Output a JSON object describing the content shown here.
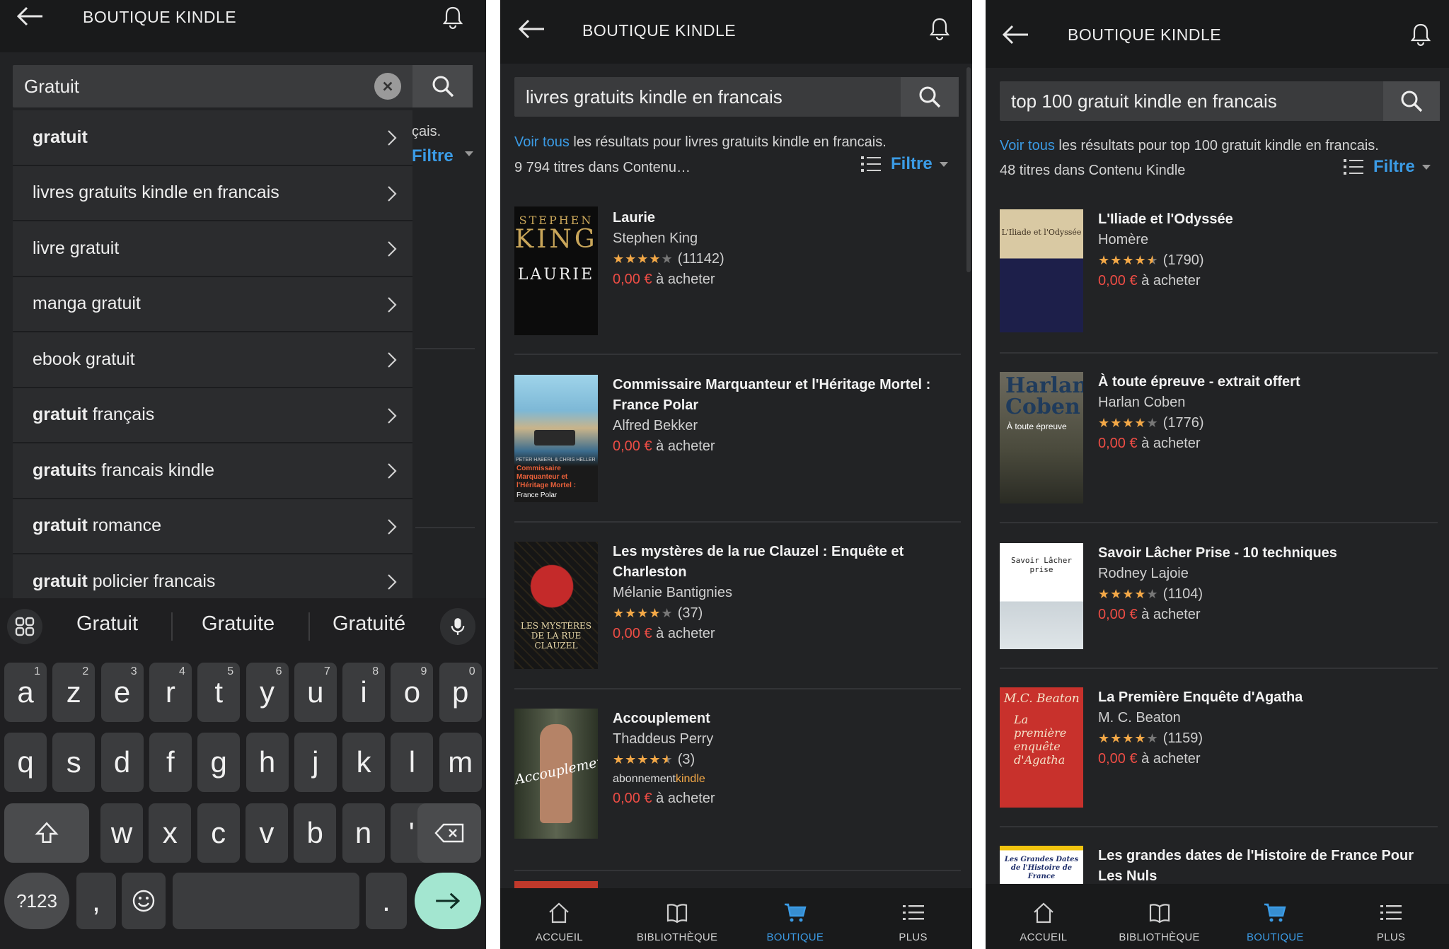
{
  "panel1": {
    "title": "BOUTIQUE KINDLE",
    "search_value": "Gratuit",
    "behind_text_1": "çais.",
    "behind_text_2": "Filtre",
    "suggestions": [
      {
        "bold": "gratuit",
        "rest": ""
      },
      {
        "bold": "",
        "rest": "livres gratuits kindle en francais"
      },
      {
        "bold": "",
        "rest": "livre gratuit"
      },
      {
        "bold": "",
        "rest": "manga gratuit"
      },
      {
        "bold": "",
        "rest": "ebook gratuit"
      },
      {
        "bold": "gratuit",
        "rest": " français"
      },
      {
        "bold": "gratuit",
        "rest": "s francais kindle"
      },
      {
        "bold": "gratuit",
        "rest": " romance"
      },
      {
        "bold": "gratuit",
        "rest": " policier francais"
      }
    ],
    "keyboard": {
      "word_suggestions": [
        "Gratuit",
        "Gratuite",
        "Gratuité"
      ],
      "row1": [
        {
          "k": "a",
          "s": "1"
        },
        {
          "k": "z",
          "s": "2"
        },
        {
          "k": "e",
          "s": "3"
        },
        {
          "k": "r",
          "s": "4"
        },
        {
          "k": "t",
          "s": "5"
        },
        {
          "k": "y",
          "s": "6"
        },
        {
          "k": "u",
          "s": "7"
        },
        {
          "k": "i",
          "s": "8"
        },
        {
          "k": "o",
          "s": "9"
        },
        {
          "k": "p",
          "s": "0"
        }
      ],
      "row2": [
        "q",
        "s",
        "d",
        "f",
        "g",
        "h",
        "j",
        "k",
        "l",
        "m"
      ],
      "row3": [
        "w",
        "x",
        "c",
        "v",
        "b",
        "n",
        "'"
      ],
      "num_key": "?123",
      "comma": ",",
      "period": "."
    }
  },
  "panel2": {
    "title": "BOUTIQUE KINDLE",
    "search_value": "livres gratuits kindle en francais",
    "results_link": "Voir tous",
    "results_rest": " les résultats pour livres gratuits kindle en francais.",
    "count": "9 794 titres dans Contenu…",
    "filter": "Filtre",
    "books": [
      {
        "title": "Laurie",
        "author": "Stephen King",
        "stars": 4,
        "reviews": "(11142)",
        "price": "0,00 €",
        "price_suffix": " à acheter"
      },
      {
        "title": "Commissaire Marquanteur et l'Héritage Mortel : France Polar",
        "author": "Alfred Bekker",
        "price": "0,00 €",
        "price_suffix": " à acheter"
      },
      {
        "title": "Les mystères de la rue Clauzel : Enquête et Charleston",
        "author": "Mélanie Bantignies",
        "stars": 4,
        "reviews": "(37)",
        "price": "0,00 €",
        "price_suffix": " à acheter"
      },
      {
        "title": "Accouplement",
        "author": "Thaddeus Perry",
        "stars": 4.5,
        "reviews": "(3)",
        "badge_a": "abonnement",
        "badge_b": "kindle",
        "price": "0,00 €",
        "price_suffix": " à acheter"
      }
    ],
    "nav": [
      "ACCUEIL",
      "BIBLIOTHÈQUE",
      "BOUTIQUE",
      "PLUS"
    ]
  },
  "panel3": {
    "title": "BOUTIQUE KINDLE",
    "search_value": "top 100 gratuit kindle en francais",
    "results_link": "Voir tous",
    "results_rest": " les résultats pour top 100 gratuit kindle en francais.",
    "count": "48 titres dans Contenu Kindle",
    "filter": "Filtre",
    "books": [
      {
        "title": "L'Iliade et l'Odyssée",
        "author": "Homère",
        "stars": 4.5,
        "reviews": "(1790)",
        "price": "0,00 €",
        "price_suffix": " à acheter",
        "cover_text": "L'Iliade et l'Odyssée"
      },
      {
        "title": "À toute épreuve - extrait offert",
        "author": "Harlan Coben",
        "stars": 4,
        "reviews": "(1776)",
        "price": "0,00 €",
        "price_suffix": " à acheter",
        "cover_text_1": "Harlan",
        "cover_text_2": "Coben",
        "cover_text_3": "À toute épreuve"
      },
      {
        "title": "Savoir Lâcher Prise - 10 techniques",
        "author": "Rodney Lajoie",
        "stars": 4,
        "reviews": "(1104)",
        "price": "0,00 €",
        "price_suffix": " à acheter",
        "cover_text": "Savoir Lâcher prise"
      },
      {
        "title": "La Première Enquête d'Agatha",
        "author": "M. C. Beaton",
        "stars": 4,
        "reviews": "(1159)",
        "price": "0,00 €",
        "price_suffix": " à acheter",
        "cover_text_1": "M.C. Beaton",
        "cover_text_2": "La première enquête d'Agatha"
      },
      {
        "title": "Les grandes dates de l'Histoire de France Pour Les Nuls",
        "cover_text": "Les Grandes Dates de l'Histoire de France"
      }
    ],
    "nav": [
      "ACCUEIL",
      "BIBLIOTHÈQUE",
      "BOUTIQUE",
      "PLUS"
    ]
  },
  "p2covers": {
    "c1a": "STEPHEN",
    "c1b": "KING",
    "c1c": "LAURIE",
    "c2a": "PETER HABERL & CHRIS HELLER",
    "c2b": "Commissaire Marquanteur et l'Héritage Mortel :",
    "c2c": "France Polar",
    "c3": "LES MYSTÈRES DE LA RUE CLAUZEL",
    "c4": "Accouplement"
  },
  "colors": {
    "accent": "#3b9be5",
    "price": "#ee4d45",
    "star": "#f3a847",
    "bg": "#222325",
    "bar": "#191a1b"
  }
}
